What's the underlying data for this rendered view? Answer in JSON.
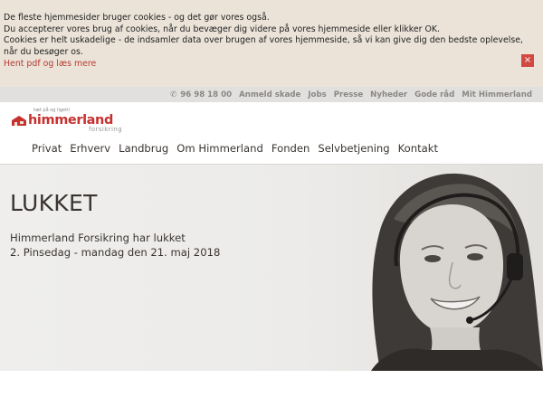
{
  "cookie_banner": {
    "lines": [
      "De fleste hjemmesider bruger cookies - og det gør vores også.",
      "Du accepterer vores brug af cookies, når du bevæger dig videre på vores hjemmeside eller klikker OK.",
      "Cookies er helt uskadelige - de indsamler data over brugen af vores hjemmeside, så vi kan give dig den bedste oplevelse, når du besøger os."
    ],
    "link": "Hent pdf og læs mere",
    "close": "×"
  },
  "utility_bar": {
    "phone": "96 98 18 00",
    "links": [
      "Anmeld skade",
      "Jobs",
      "Presse",
      "Nyheder",
      "Gode råd",
      "Mit Himmerland"
    ]
  },
  "logo": {
    "tagline": "tæt på og ligetil",
    "name": "himmerland",
    "sub": "forsikring",
    "brand_color": "#c6312f"
  },
  "nav": {
    "items": [
      "Privat",
      "Erhverv",
      "Landbrug",
      "Om Himmerland",
      "Fonden",
      "Selvbetjening",
      "Kontakt"
    ]
  },
  "hero": {
    "title": "LUKKET",
    "line1": "Himmerland Forsikring har lukket",
    "line2": "2. Pinsedag - mandag den 21. maj 2018"
  }
}
